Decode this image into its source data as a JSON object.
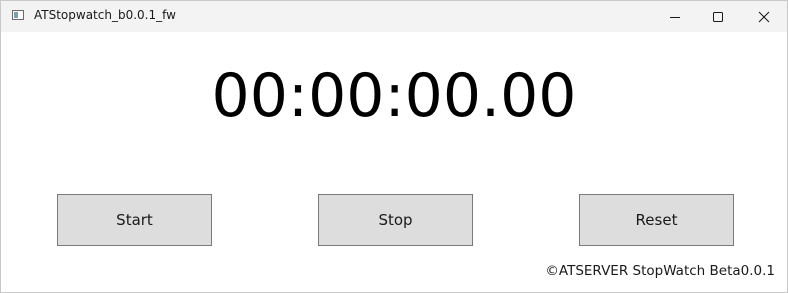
{
  "window": {
    "title": "ATStopwatch_b0.0.1_fw",
    "icons": {
      "app": "app-icon",
      "minimize": "minimize-icon",
      "maximize": "maximize-icon",
      "close": "close-icon"
    }
  },
  "clock": {
    "time": "00:00:00.00"
  },
  "buttons": {
    "start_label": "Start",
    "stop_label": "Stop",
    "reset_label": "Reset"
  },
  "footer": {
    "copyright": "©ATSERVER StopWatch Beta0.0.1"
  },
  "colors": {
    "button_bg": "#dddddd",
    "button_border": "#7a7a7a",
    "titlebar_bg": "#f3f3f3",
    "text": "#000000"
  }
}
